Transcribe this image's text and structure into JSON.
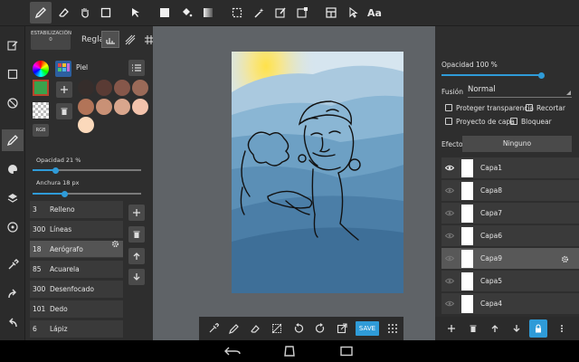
{
  "toolbar": {
    "tools": [
      "pen-icon",
      "eraser-icon",
      "hand-icon",
      "rect-select-icon",
      "move-icon",
      "fill-rect-icon",
      "bucket-icon",
      "gradient-icon",
      "lasso-icon",
      "magic-wand-icon",
      "select-pen-icon",
      "select-eraser-icon",
      "panel-icon",
      "pointer-icon"
    ],
    "text_tool_label": "Aa"
  },
  "brush_panel": {
    "stabilizer_label": "ESTABILIZACIÓN",
    "stabilizer_value": "0",
    "ruler_label": "Regla",
    "color_name": "Piel",
    "rgb_label": "RGB",
    "opacity_label": "Opacidad 21 %",
    "opacity_value": 0.21,
    "width_label": "Anchura 18 px",
    "width_value": 0.29,
    "swatches": [
      "#352d2b",
      "#5a3b34",
      "#86574a",
      "#9a6a58",
      "#b27458",
      "#c99176",
      "#d9a68d",
      "#f3c3ac",
      "#fbd9bb"
    ],
    "brushes": [
      {
        "size": "3",
        "name": "Relleno"
      },
      {
        "size": "300",
        "name": "Líneas"
      },
      {
        "size": "18",
        "name": "Aerógrafo"
      },
      {
        "size": "85",
        "name": "Acuarela"
      },
      {
        "size": "300",
        "name": "Desenfocado"
      },
      {
        "size": "101",
        "name": "Dedo"
      },
      {
        "size": "6",
        "name": "Lápiz"
      }
    ]
  },
  "bottom_tools": {
    "save_label": "SAVE"
  },
  "layers_panel": {
    "opacity_label": "Opacidad 100 %",
    "opacity_value": 1.0,
    "blend_label": "Fusión",
    "blend_value": "Normal",
    "protect_alpha": "Proteger transparencia",
    "clip": "Recortar",
    "layer_project": "Proyecto de capa",
    "lock": "Bloquear",
    "effect_label": "Efecto",
    "effect_value": "Ninguno",
    "layers": [
      "Capa1",
      "Capa8",
      "Capa7",
      "Capa6",
      "Capa9",
      "Capa5",
      "Capa4"
    ]
  },
  "colors": {
    "accent": "#2f9bd8"
  }
}
